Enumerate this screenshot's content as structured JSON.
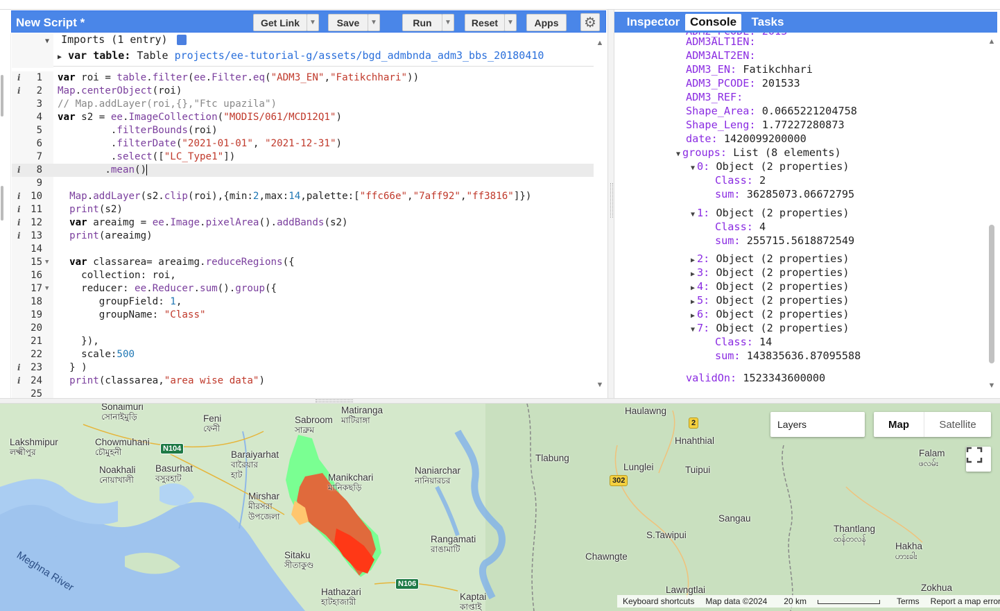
{
  "editor": {
    "title": "New Script *",
    "buttons": {
      "get_link": "Get Link",
      "save": "Save",
      "run": "Run",
      "reset": "Reset",
      "apps": "Apps"
    },
    "imports": {
      "header": "Imports (1 entry)",
      "var_kw": "var",
      "var_name": "table:",
      "var_type": "Table",
      "var_path": "projects/ee-tutorial-g/assets/bgd_admbnda_adm3_bbs_20180410"
    },
    "line_numbers": [
      "1",
      "2",
      "3",
      "4",
      "5",
      "6",
      "7",
      "8",
      "9",
      "10",
      "11",
      "12",
      "13",
      "14",
      "15",
      "16",
      "17",
      "18",
      "19",
      "20",
      "21",
      "22",
      "23",
      "24",
      "25"
    ]
  },
  "console": {
    "tabs": [
      "Inspector",
      "Console",
      "Tasks"
    ],
    "partial_top": "ADM2_PCODE: 2013",
    "props": [
      {
        "k": "ADM3ALT1EN:",
        "v": ""
      },
      {
        "k": "ADM3ALT2EN:",
        "v": ""
      },
      {
        "k": "ADM3_EN:",
        "v": "Fatikchhari"
      },
      {
        "k": "ADM3_PCODE:",
        "v": "201533"
      },
      {
        "k": "ADM3_REF:",
        "v": ""
      },
      {
        "k": "Shape_Area:",
        "v": "0.0665221204758"
      },
      {
        "k": "Shape_Leng:",
        "v": "1.77227280873"
      },
      {
        "k": "date:",
        "v": "1420099200000"
      }
    ],
    "groups_label": "groups:",
    "groups_value": "List (8 elements)",
    "group0": {
      "k": "0:",
      "v": "Object (2 properties)",
      "class_k": "Class:",
      "class_v": "2",
      "sum_k": "sum:",
      "sum_v": "36285073.06672795"
    },
    "group1": {
      "k": "1:",
      "v": "Object (2 properties)",
      "class_k": "Class:",
      "class_v": "4",
      "sum_k": "sum:",
      "sum_v": "255715.5618872549"
    },
    "collapsed": [
      {
        "k": "2:",
        "v": "Object (2 properties)"
      },
      {
        "k": "3:",
        "v": "Object (2 properties)"
      },
      {
        "k": "4:",
        "v": "Object (2 properties)"
      },
      {
        "k": "5:",
        "v": "Object (2 properties)"
      },
      {
        "k": "6:",
        "v": "Object (2 properties)"
      }
    ],
    "group7": {
      "k": "7:",
      "v": "Object (2 properties)",
      "class_k": "Class:",
      "class_v": "14",
      "sum_k": "sum:",
      "sum_v": "143835636.87095588"
    },
    "validon_k": "validOn:",
    "validon_v": "1523343600000"
  },
  "map": {
    "labels": {
      "sonaimuri": "Sonaimuri",
      "sonaimuri_bn": "সোনাইমুড়ি",
      "feni": "Feni",
      "feni_bn": "ফেনী",
      "sabroom": "Sabroom",
      "sabroom_bn": "সাব্রুম",
      "matiranga": "Matiranga",
      "matiranga_bn": "মাটিরাঙ্গা",
      "lakshmipur": "Lakshmipur",
      "lakshmipur_bn": "লক্ষ্মীপুর",
      "chowmuhani": "Chowmuhani",
      "chowmuhani_bn": "চৌমুহনী",
      "baraiyarhat": "Baraiyarhat",
      "baraiyarhat_bn1": "বারৈয়ার",
      "baraiyarhat_bn2": "হাট",
      "noakhali": "Noakhali",
      "noakhali_bn": "নোয়াখালী",
      "basurhat": "Basurhat",
      "basurhat_bn": "বসুরহাট",
      "manikchari": "Manikchari",
      "manikchari_bn": "মানিকছড়ি",
      "naniarchar": "Naniarchar",
      "naniarchar_bn": "নানিয়ারচর",
      "mirsharai": "Mirshar",
      "mirsharai_bn1": "মীরসরা",
      "mirsharai_bn2": "উপজেলা",
      "sitakund": "Sitaku",
      "sitakund_bn": "সীতাকুণ্ড",
      "rangamati": "Rangamati",
      "rangamati_bn": "রাঙামাটি",
      "hathazari": "Hathazari",
      "hathazari_bn": "হাটহাজারী",
      "kaptai": "Kaptai",
      "kaptai_bn": "কাপ্তাই",
      "haulawng": "Haulawng",
      "hnahthial": "Hnahthial",
      "tlabung": "Tlabung",
      "lunglei": "Lunglei",
      "tuipui": "Tuipui",
      "sangau": "Sangau",
      "stawipui": "S.Tawipui",
      "chawngte": "Chawngte",
      "lawngtlai": "Lawngtlai",
      "thantlang": "Thantlang",
      "thantlang_my": "ထန်တလန်",
      "hakha": "Hakha",
      "hakha_my": "ဟားခါး",
      "falam": "Falam",
      "falam_my": "ဖလမ်း",
      "zokhua": "Zokhua",
      "meghna": "Meghna River"
    },
    "shields": {
      "n104": "N104",
      "n106": "N106",
      "r2": "2",
      "r302": "302"
    },
    "layers": "Layers",
    "map_btn": "Map",
    "satellite_btn": "Satellite",
    "attribution": {
      "shortcuts": "Keyboard shortcuts",
      "mapdata": "Map data ©2024",
      "scale": "20 km",
      "terms": "Terms",
      "report": "Report a map error"
    },
    "palette": [
      "ffc66e",
      "7aff92",
      "ff3816"
    ]
  }
}
